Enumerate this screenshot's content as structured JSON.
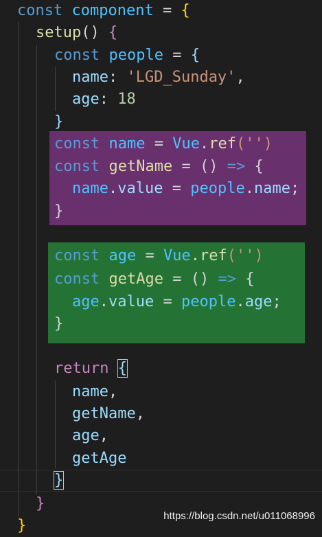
{
  "code": {
    "l1": {
      "kw": "const",
      "name": "component",
      "op": " = ",
      "open": "{"
    },
    "l2": {
      "fn": "setup",
      "paren": "()",
      "open": " {"
    },
    "l3": {
      "kw": "const",
      "name": "people",
      "op": " = ",
      "open": "{"
    },
    "l4": {
      "key": "name",
      "colon": ": ",
      "value": "'LGD_Sunday'",
      "comma": ","
    },
    "l5": {
      "key": "age",
      "colon": ": ",
      "value": "18"
    },
    "l6": {
      "close": "}"
    },
    "l7": {
      "kw": "const",
      "name": "name",
      "op": " = ",
      "obj": "Vue",
      "dot": ".",
      "fn": "ref",
      "args": "('')"
    },
    "l8": {
      "kw": "const",
      "name": "getName",
      "op": " = ",
      "paren": "()",
      "arrow": " => ",
      "open": "{"
    },
    "l9": {
      "target": "name",
      "dot1": ".",
      "prop": "value",
      "op": " = ",
      "obj": "people",
      "dot2": ".",
      "src": "name",
      "semi": ";"
    },
    "l10": {
      "close": "}"
    },
    "l11": {
      "kw": "const",
      "name": "age",
      "op": " = ",
      "obj": "Vue",
      "dot": ".",
      "fn": "ref",
      "args": "('')"
    },
    "l12": {
      "kw": "const",
      "name": "getAge",
      "op": " = ",
      "paren": "()",
      "arrow": " => ",
      "open": "{"
    },
    "l13": {
      "target": "age",
      "dot1": ".",
      "prop": "value",
      "op": " = ",
      "obj": "people",
      "dot2": ".",
      "src": "age",
      "semi": ";"
    },
    "l14": {
      "close": "}"
    },
    "l15": {
      "kw": "return",
      "open": "{"
    },
    "l16": {
      "item": "name",
      "comma": ","
    },
    "l17": {
      "item": "getName",
      "comma": ","
    },
    "l18": {
      "item": "age",
      "comma": ","
    },
    "l19": {
      "item": "getAge"
    },
    "l20": {
      "close": "}"
    },
    "l21": {
      "close": "}"
    },
    "l22": {
      "close": "}"
    }
  },
  "watermark": "https://blog.csdn.net/u011068996",
  "colors": {
    "background": "#1e1e1e",
    "highlight_purple": "#7a3480",
    "highlight_green": "#258038"
  }
}
